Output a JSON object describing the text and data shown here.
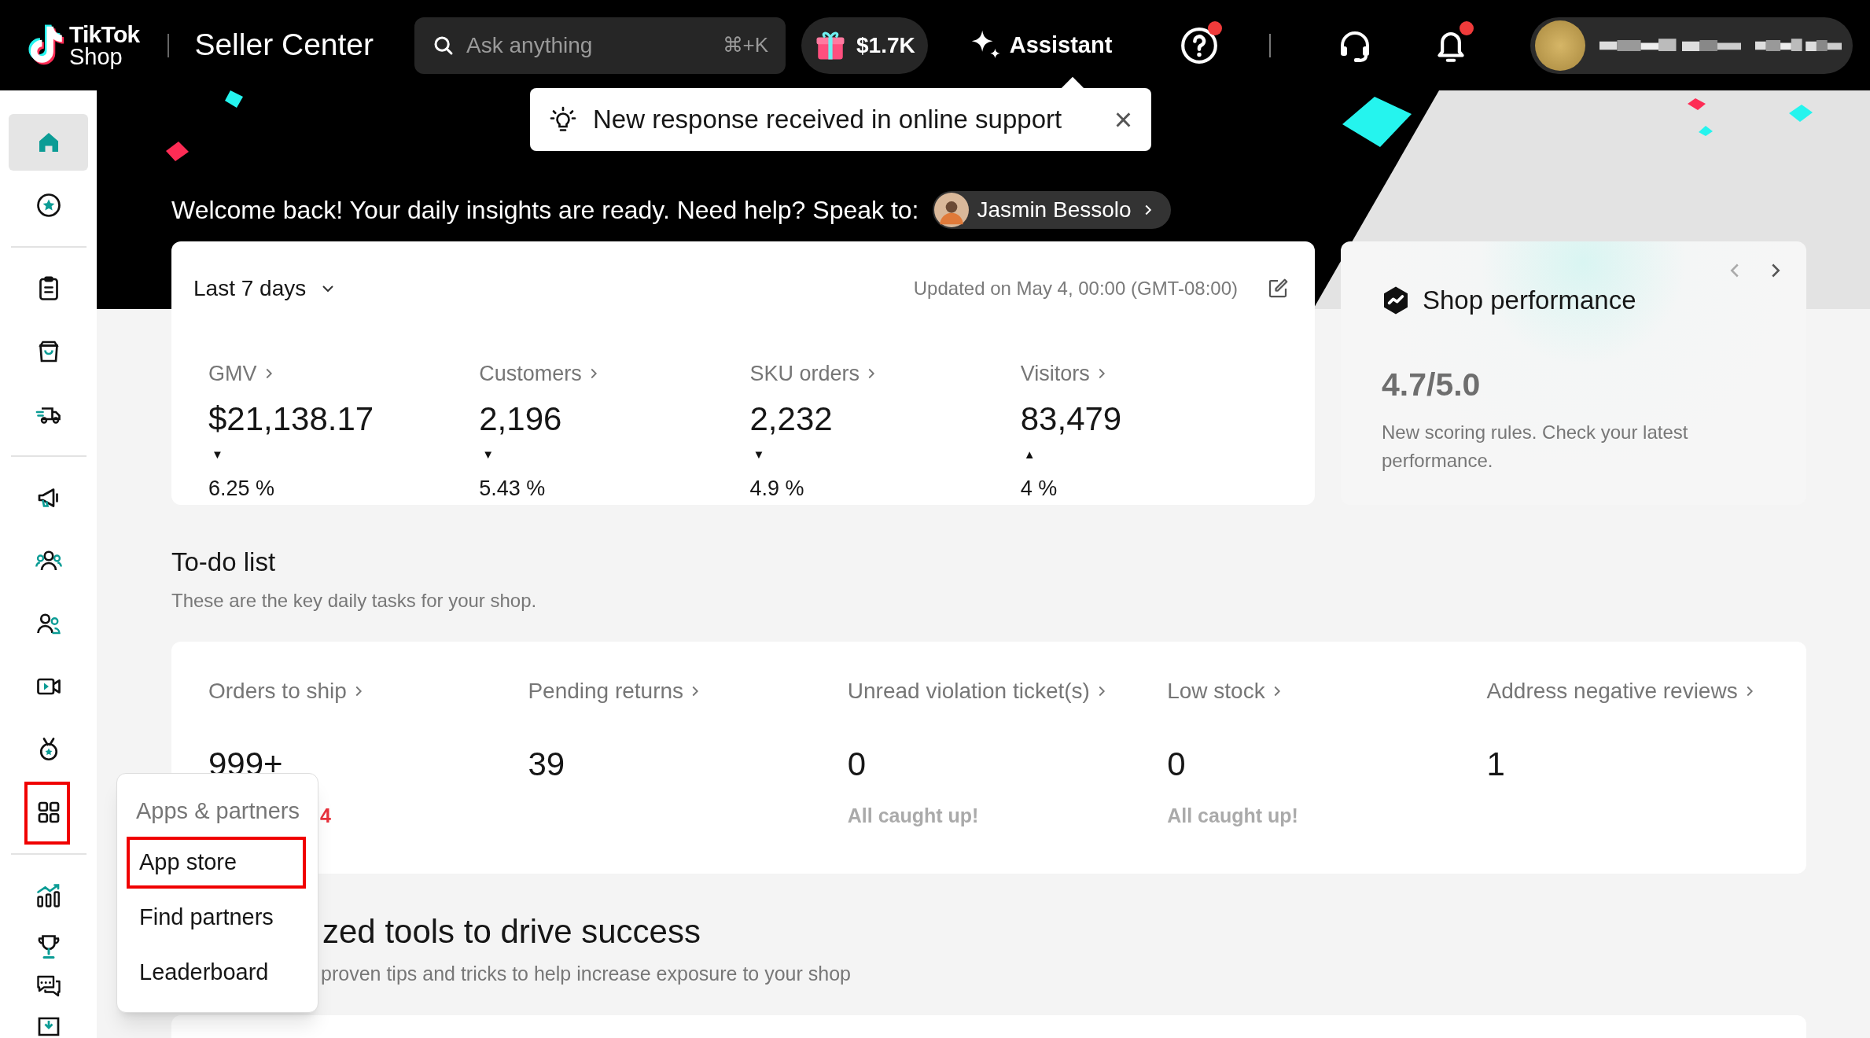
{
  "topbar": {
    "brand": "TikTok",
    "brand_sub": "Shop",
    "product": "Seller Center",
    "search": {
      "placeholder": "Ask anything",
      "shortcut": "⌘+K"
    },
    "rewards": "$1.7K",
    "assistant": "Assistant",
    "help_badge": true,
    "bell_badge": true
  },
  "toast": {
    "message": "New response received in online support",
    "close": "×"
  },
  "welcome": {
    "text": "Welcome back! Your daily insights are ready. Need help? Speak to:",
    "contact": "Jasmin Bessolo"
  },
  "sidebar": {
    "items": [
      {
        "kind": "home",
        "selected": true,
        "highlighted": false
      },
      {
        "kind": "star",
        "selected": false,
        "highlighted": false
      },
      {
        "kind": "divider"
      },
      {
        "kind": "clipboard",
        "selected": false,
        "highlighted": false
      },
      {
        "kind": "bag",
        "selected": false,
        "highlighted": false
      },
      {
        "kind": "truck",
        "selected": false,
        "highlighted": false
      },
      {
        "kind": "divider"
      },
      {
        "kind": "megaphone",
        "selected": false,
        "highlighted": false
      },
      {
        "kind": "group",
        "selected": false,
        "highlighted": false
      },
      {
        "kind": "people",
        "selected": false,
        "highlighted": false
      },
      {
        "kind": "video",
        "selected": false,
        "highlighted": false
      },
      {
        "kind": "medal",
        "selected": false,
        "highlighted": false
      },
      {
        "kind": "apps",
        "selected": false,
        "highlighted": true
      },
      {
        "kind": "divider"
      },
      {
        "kind": "chart",
        "selected": false,
        "highlighted": false
      },
      {
        "kind": "trophy",
        "selected": false,
        "highlighted": false
      },
      {
        "kind": "chat",
        "selected": false,
        "highlighted": false
      },
      {
        "kind": "download",
        "selected": false,
        "highlighted": false
      }
    ]
  },
  "metrics": {
    "range": "Last 7 days",
    "updated": "Updated on May 4, 00:00 (GMT-08:00)",
    "items": [
      {
        "label": "GMV",
        "value": "$21,138.17",
        "trend": "▼",
        "change": "6.25 %"
      },
      {
        "label": "Customers",
        "value": "2,196",
        "trend": "▼",
        "change": "5.43 %"
      },
      {
        "label": "SKU orders",
        "value": "2,232",
        "trend": "▼",
        "change": "4.9 %"
      },
      {
        "label": "Visitors",
        "value": "83,479",
        "trend": "▲",
        "change": "4 %"
      }
    ]
  },
  "shop_performance": {
    "title": "Shop performance",
    "score": "4.7/5.0",
    "note": "New scoring rules. Check your latest performance."
  },
  "todo": {
    "title": "To-do list",
    "subtitle": "These are the key daily tasks for your shop.",
    "items": [
      {
        "label": "Orders to ship",
        "value": "999+",
        "note": "4",
        "color": "#e8313c"
      },
      {
        "label": "Pending returns",
        "value": "39"
      },
      {
        "label": "Unread violation ticket(s)",
        "value": "0",
        "note": "All caught up!",
        "color": "#aaaaaa"
      },
      {
        "label": "Low stock",
        "value": "0",
        "note": "All caught up!",
        "color": "#aaaaaa"
      },
      {
        "label": "Address negative reviews",
        "value": "1"
      }
    ]
  },
  "tools": {
    "title": "zed tools to drive success",
    "subtitle": "proven tips and tricks to help increase exposure to your shop"
  },
  "apps_menu": {
    "title": "Apps & partners",
    "items": [
      {
        "label": "App store",
        "highlighted": true
      },
      {
        "label": "Find partners",
        "highlighted": false
      },
      {
        "label": "Leaderboard",
        "highlighted": false
      }
    ]
  }
}
